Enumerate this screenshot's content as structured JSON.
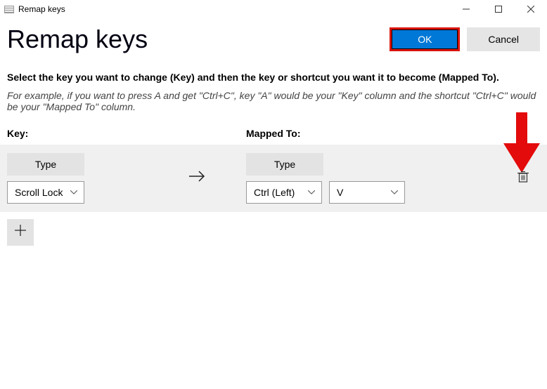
{
  "window": {
    "title": "Remap keys"
  },
  "header": {
    "title": "Remap keys",
    "ok": "OK",
    "cancel": "Cancel"
  },
  "instruction": "Select the key you want to change (Key) and then the key or shortcut you want it to become (Mapped To).",
  "example": "For example, if you want to press A and get \"Ctrl+C\", key \"A\" would be your \"Key\" column and the shortcut \"Ctrl+C\" would be your \"Mapped To\" column.",
  "columns": {
    "key": "Key:",
    "mapped": "Mapped To:"
  },
  "row": {
    "type_label": "Type",
    "key_value": "Scroll Lock",
    "mapped_mod": "Ctrl (Left)",
    "mapped_key": "V"
  }
}
